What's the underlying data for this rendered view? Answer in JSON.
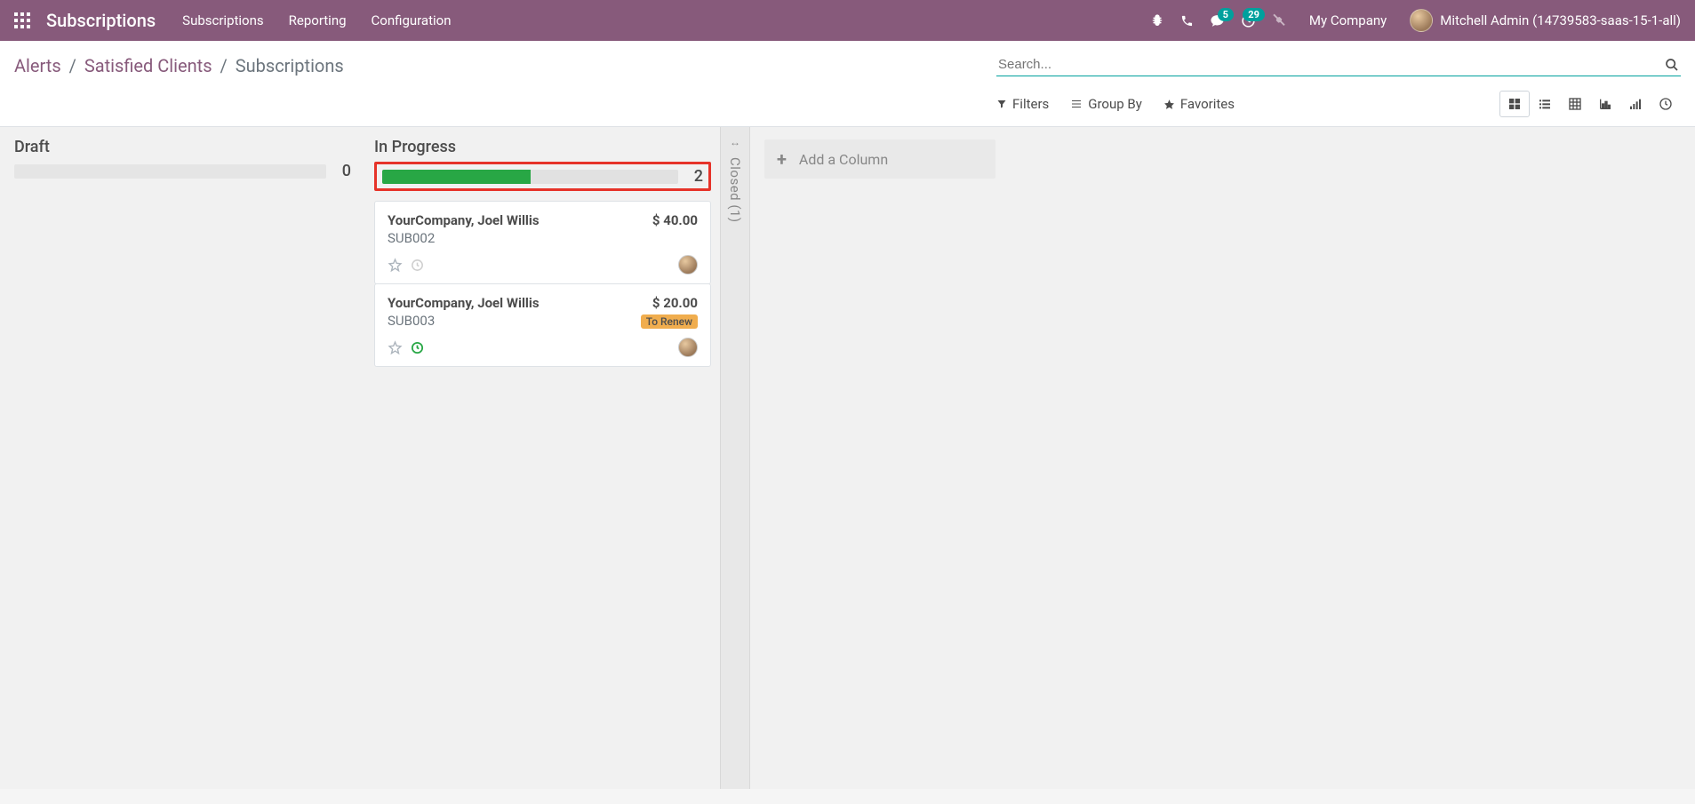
{
  "nav": {
    "brand": "Subscriptions",
    "items": [
      "Subscriptions",
      "Reporting",
      "Configuration"
    ],
    "badges": {
      "messages": "5",
      "activities": "29"
    },
    "company": "My Company",
    "user": "Mitchell Admin (14739583-saas-15-1-all)"
  },
  "breadcrumb": {
    "a": "Alerts",
    "b": "Satisfied Clients",
    "c": "Subscriptions"
  },
  "search": {
    "placeholder": "Search..."
  },
  "filters": {
    "filters": "Filters",
    "groupby": "Group By",
    "favorites": "Favorites"
  },
  "columns": {
    "draft": {
      "title": "Draft",
      "count": "0"
    },
    "in_progress": {
      "title": "In Progress",
      "count": "2",
      "progress_pct": 50,
      "cards": [
        {
          "title": "YourCompany, Joel Willis",
          "amount": "$ 40.00",
          "sub": "SUB002",
          "tag": "",
          "activity": "late"
        },
        {
          "title": "YourCompany, Joel Willis",
          "amount": "$ 20.00",
          "sub": "SUB003",
          "tag": "To Renew",
          "activity": "today"
        }
      ]
    },
    "closed": {
      "label": "Closed (1)"
    },
    "add": {
      "label": "Add a Column"
    }
  }
}
